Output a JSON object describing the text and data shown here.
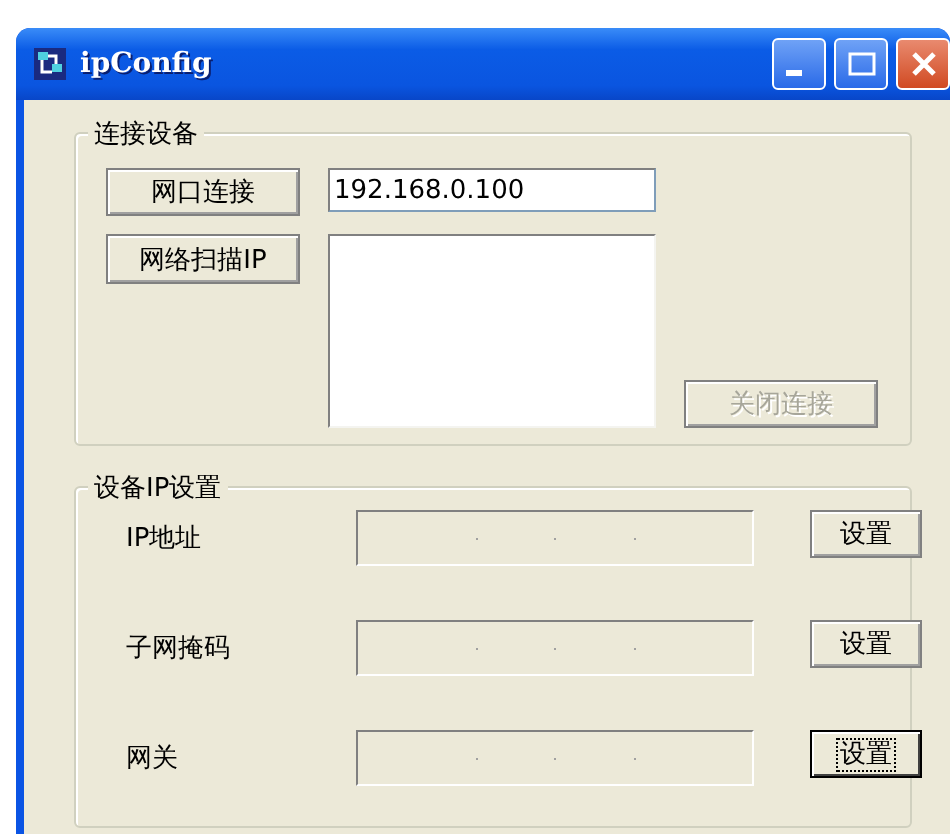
{
  "window": {
    "title": "ipConfig"
  },
  "connect_group": {
    "title": "连接设备",
    "connect_button": "网口连接",
    "ip_value": "192.168.0.100",
    "scan_button": "网络扫描IP",
    "close_button": {
      "label": "关闭连接",
      "disabled": true
    }
  },
  "ip_group": {
    "title": "设备IP设置",
    "rows": [
      {
        "label": "IP地址",
        "disabled": true,
        "button": "设置",
        "focused": false
      },
      {
        "label": "子网掩码",
        "disabled": true,
        "button": "设置",
        "focused": false
      },
      {
        "label": "网关",
        "disabled": true,
        "button": "设置",
        "focused": true
      }
    ]
  }
}
